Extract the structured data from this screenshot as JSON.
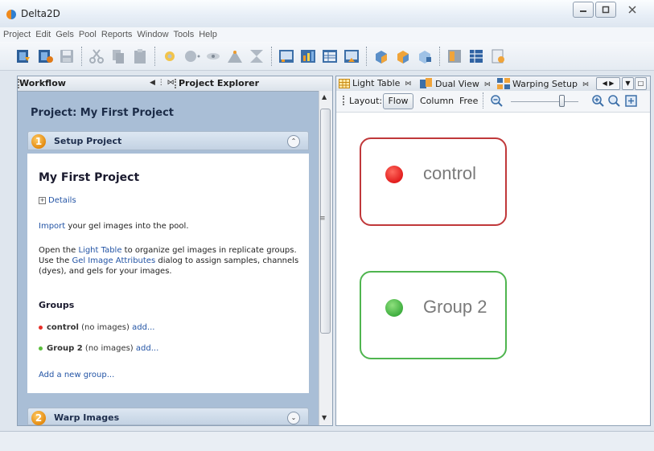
{
  "window": {
    "title": "Delta2D"
  },
  "menu": [
    "Project",
    "Edit",
    "Gels",
    "Pool",
    "Reports",
    "Window",
    "Tools",
    "Help"
  ],
  "left_panel": {
    "tab_workflow": "Workflow",
    "tab_explorer": "Project Explorer",
    "project_title": "Project: My First Project",
    "step1": {
      "number": "1",
      "label": "Setup Project"
    },
    "step2": {
      "number": "2",
      "label": "Warp Images"
    },
    "body": {
      "heading": "My First Project",
      "details": "Details",
      "import_link": "Import",
      "import_text": " your gel images into the pool.",
      "open_text_1": "Open the ",
      "light_table_link": "Light Table",
      "open_text_2": " to organize gel images in replicate groups.",
      "use_text_1": "Use the ",
      "gel_attr_link": "Gel Image Attributes",
      "use_text_2": " dialog to assign samples, channels",
      "use_text_3": "(dyes), and gels for your images.",
      "groups_heading": "Groups",
      "groups": [
        {
          "name": "control",
          "note": " (no images) ",
          "add": "add...",
          "color": "#e8312a"
        },
        {
          "name": "Group 2",
          "note": " (no images) ",
          "add": "add...",
          "color": "#5bbd3c"
        }
      ],
      "add_group": "Add a new group..."
    }
  },
  "right_panel": {
    "tabs": [
      "Light Table",
      "Dual View",
      "Warping Setup"
    ],
    "layout_label": "Layout:",
    "layout_options": [
      "Flow",
      "Column",
      "Free"
    ],
    "zoom_level": 0.75,
    "groups": [
      {
        "name": "control",
        "color": "#e21d1d",
        "border": "#c0383a"
      },
      {
        "name": "Group 2",
        "color": "#3fae3f",
        "border": "#4fb54f"
      }
    ]
  }
}
